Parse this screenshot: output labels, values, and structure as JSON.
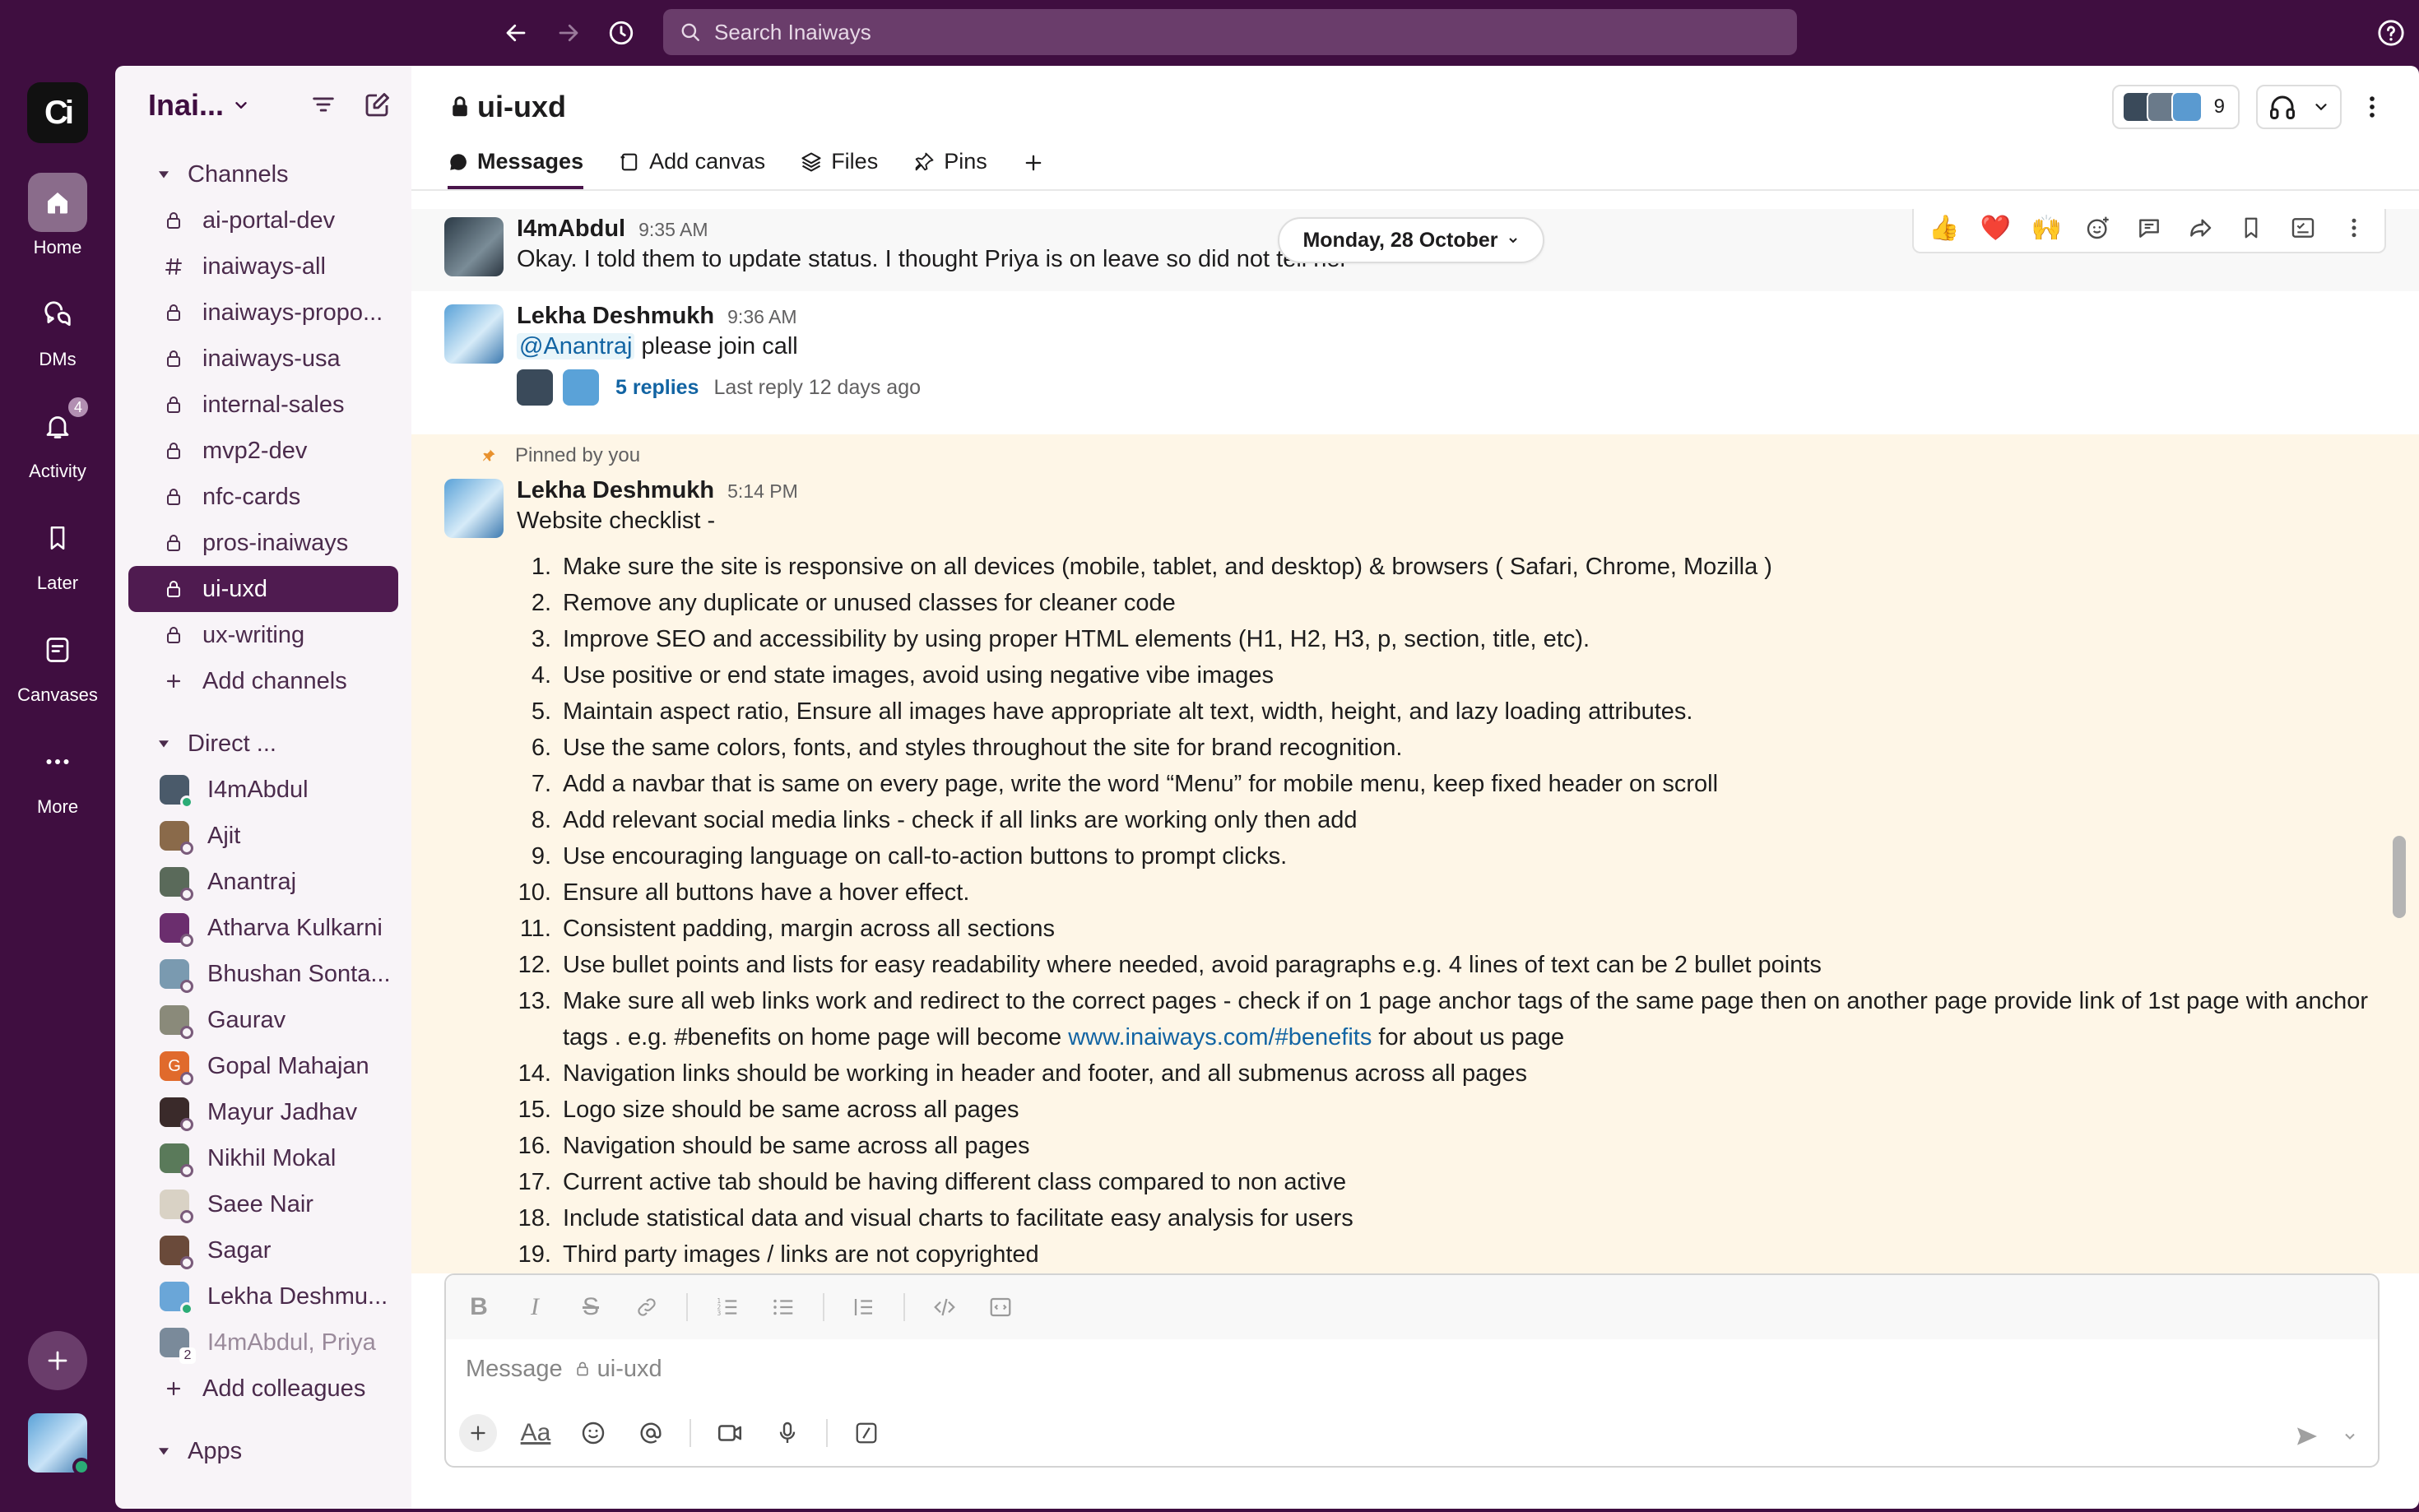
{
  "search": {
    "placeholder": "Search Inaiways"
  },
  "workspace": {
    "logo_text": "Ci",
    "name": "Inai..."
  },
  "rail": [
    {
      "label": "Home",
      "icon": "home-icon",
      "active": true
    },
    {
      "label": "DMs",
      "icon": "dms-icon"
    },
    {
      "label": "Activity",
      "icon": "bell-icon",
      "badge": "4"
    },
    {
      "label": "Later",
      "icon": "bookmark-icon"
    },
    {
      "label": "Canvases",
      "icon": "canvas-icon"
    },
    {
      "label": "More",
      "icon": "more-icon"
    }
  ],
  "sidebar": {
    "channels_header": "Channels",
    "channels": [
      {
        "name": "ai-portal-dev",
        "icon": "lock"
      },
      {
        "name": "inaiways-all",
        "icon": "hash"
      },
      {
        "name": "inaiways-propo...",
        "icon": "lock"
      },
      {
        "name": "inaiways-usa",
        "icon": "lock"
      },
      {
        "name": "internal-sales",
        "icon": "lock"
      },
      {
        "name": "mvp2-dev",
        "icon": "lock"
      },
      {
        "name": "nfc-cards",
        "icon": "lock"
      },
      {
        "name": "pros-inaiways",
        "icon": "lock"
      },
      {
        "name": "ui-uxd",
        "icon": "lock",
        "active": true
      },
      {
        "name": "ux-writing",
        "icon": "lock"
      }
    ],
    "add_channels": "Add channels",
    "dm_header": "Direct ...",
    "dms": [
      {
        "name": "I4mAbdul",
        "online": true,
        "color": "#4a5a6a"
      },
      {
        "name": "Ajit",
        "online": false,
        "color": "#8a6a4a"
      },
      {
        "name": "Anantraj",
        "online": false,
        "color": "#5a6a5a"
      },
      {
        "name": "Atharva Kulkarni",
        "online": false,
        "color": "#6b2e6e"
      },
      {
        "name": "Bhushan Sonta...",
        "online": false,
        "color": "#7a9ab0"
      },
      {
        "name": "Gaurav",
        "online": false,
        "color": "#8a8a7a"
      },
      {
        "name": "Gopal Mahajan",
        "online": false,
        "color": "#e06a2c",
        "initial": "G"
      },
      {
        "name": "Mayur Jadhav",
        "online": false,
        "color": "#3a2a2a"
      },
      {
        "name": "Nikhil Mokal",
        "online": false,
        "color": "#5a7a5a"
      },
      {
        "name": "Saee Nair",
        "online": false,
        "color": "#d9d2c5"
      },
      {
        "name": "Sagar",
        "online": false,
        "color": "#6a4a3a"
      },
      {
        "name": "Lekha Deshmu...",
        "online": true,
        "color": "#6aa6d8"
      },
      {
        "name": "I4mAbdul, Priya",
        "online": false,
        "color": "#7a8a9a",
        "muted": true,
        "count": "2"
      }
    ],
    "add_colleagues": "Add colleagues",
    "apps_header": "Apps"
  },
  "channel": {
    "name": "ui-uxd",
    "member_count": "9",
    "tabs": [
      {
        "label": "Messages",
        "icon": "message-icon",
        "active": true
      },
      {
        "label": "Add canvas",
        "icon": "canvas-add-icon"
      },
      {
        "label": "Files",
        "icon": "files-icon"
      },
      {
        "label": "Pins",
        "icon": "pin-icon"
      }
    ]
  },
  "feed": {
    "date_divider": "Monday, 28 October",
    "hover_actions": [
      "👍",
      "❤️",
      "🙌",
      "add-reaction-icon",
      "reply-thread-icon",
      "forward-icon",
      "bookmark-icon",
      "save-task-icon",
      "more-icon"
    ],
    "messages": [
      {
        "author": "I4mAbdul",
        "time": "9:35 AM",
        "text": "Okay. I told them to update status. I thought Priya is on leave so did not tell her"
      },
      {
        "author": "Lekha Deshmukh",
        "time": "9:36 AM",
        "mention": "@Anantraj",
        "text": " please join call",
        "replies": "5 replies",
        "last_reply": "Last reply 12 days ago"
      }
    ],
    "pinned": {
      "label": "Pinned by you",
      "author": "Lekha Deshmukh",
      "time": "5:14 PM",
      "title": "Website checklist -",
      "items": [
        "Make sure the site is responsive on all devices (mobile, tablet, and desktop) & browsers ( Safari, Chrome, Mozilla )",
        "Remove any duplicate or unused classes for cleaner code",
        "Improve SEO and accessibility by using proper HTML elements (H1, H2, H3, p, section, title, etc).",
        "Use positive or end state images, avoid using negative vibe images",
        "Maintain aspect ratio, Ensure all images have appropriate alt text, width, height, and lazy loading attributes.",
        "Use the same colors, fonts, and styles throughout the site for brand recognition.",
        "Add a navbar that is same on every page, write the word “Menu” for mobile menu, keep fixed header on scroll",
        "Add relevant social media links - check if all links are working only then add",
        "Use encouraging language on call-to-action buttons to prompt clicks.",
        "Ensure all buttons have a hover effect.",
        "Consistent padding, margin across all sections",
        "Use bullet points and lists for easy readability where needed, avoid paragraphs e.g. 4 lines of text can be 2 bullet points",
        "Make sure all web links work and redirect to the correct pages - check if on 1 page anchor tags of the same page then on another page provide link of 1st page with anchor tags . e.g. #benefits on home page will become ",
        "Navigation links should be working in header  and footer, and all submenus across all pages",
        "Logo size should be same across all pages",
        "Navigation should be same across all pages",
        "Current active tab should be having different class compared to non active",
        "Include statistical data and visual charts to facilitate easy analysis for users",
        "Third party images / links are not copyrighted"
      ],
      "item13_link": "www.inaiways.com/#benefits",
      "item13_suffix": " for about us page"
    }
  },
  "composer": {
    "placeholder": "Message",
    "channel": "ui-uxd",
    "format_tools": [
      "bold-icon",
      "italic-icon",
      "strikethrough-icon",
      "link-icon",
      "ordered-list-icon",
      "bullet-list-icon",
      "blockquote-icon",
      "code-icon",
      "code-block-icon"
    ],
    "tools": [
      "plus-icon",
      "text-format-icon",
      "emoji-icon",
      "mention-icon",
      "video-icon",
      "microphone-icon",
      "slash-command-icon"
    ]
  }
}
